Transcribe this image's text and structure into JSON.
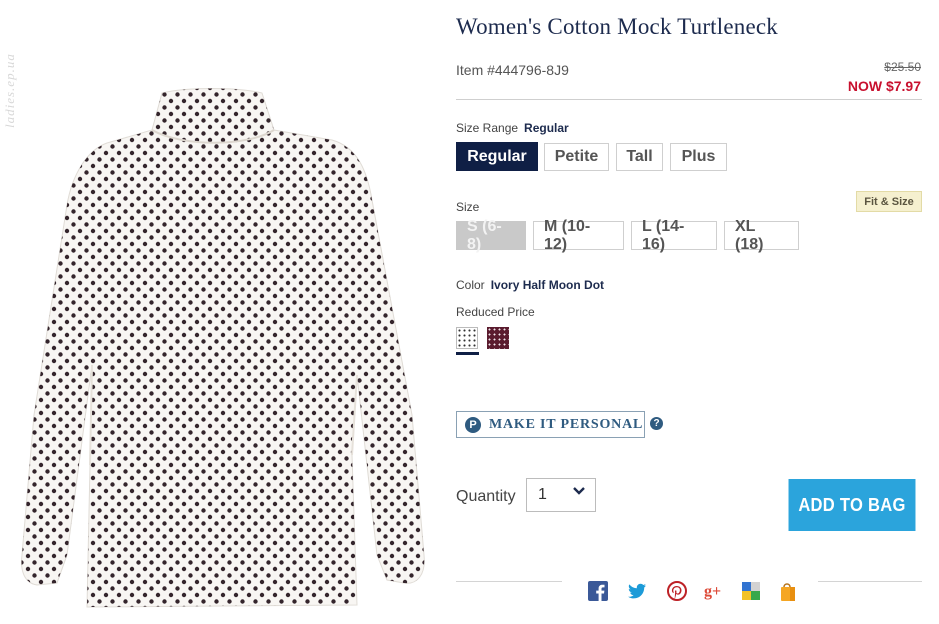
{
  "watermark": "ladies.ep.ua",
  "product": {
    "title": "Women's Cotton Mock Turtleneck",
    "item_number": "Item #444796-8J9",
    "price_original": "$25.50",
    "price_now": "NOW $7.97"
  },
  "size_range": {
    "label": "Size Range",
    "selected": "Regular",
    "options": [
      "Regular",
      "Petite",
      "Tall",
      "Plus"
    ]
  },
  "size": {
    "label": "Size",
    "fit_badge": "Fit & Size",
    "options": [
      "S (6-8)",
      "M (10-12)",
      "L (14-16)",
      "XL (18)"
    ],
    "unavailable": [
      "S (6-8)"
    ]
  },
  "color": {
    "label": "Color",
    "selected": "Ivory Half Moon Dot",
    "group_label": "Reduced Price",
    "swatches": [
      {
        "name": "Ivory Half Moon Dot",
        "hex": "#ffffff",
        "dot_hex": "#333333"
      },
      {
        "name": "plum dot",
        "hex": "#5a1b2e",
        "dot_hex": "#f1e6ea"
      }
    ]
  },
  "personalize": {
    "label": "MAKE IT PERSONAL",
    "icon": "p-circle-icon",
    "help": "?"
  },
  "quantity": {
    "label": "Quantity",
    "value": "1"
  },
  "add_to_bag": "ADD TO BAG",
  "share_icons": [
    "facebook-icon",
    "twitter-icon",
    "pinterest-icon",
    "google-plus-icon",
    "delicious-icon",
    "shopping-bag-icon"
  ],
  "colors": {
    "navy": "#0f1f45",
    "sale_red": "#c8102e",
    "cta_blue": "#2ba4dc",
    "badge_bg": "#f5f0cf"
  }
}
